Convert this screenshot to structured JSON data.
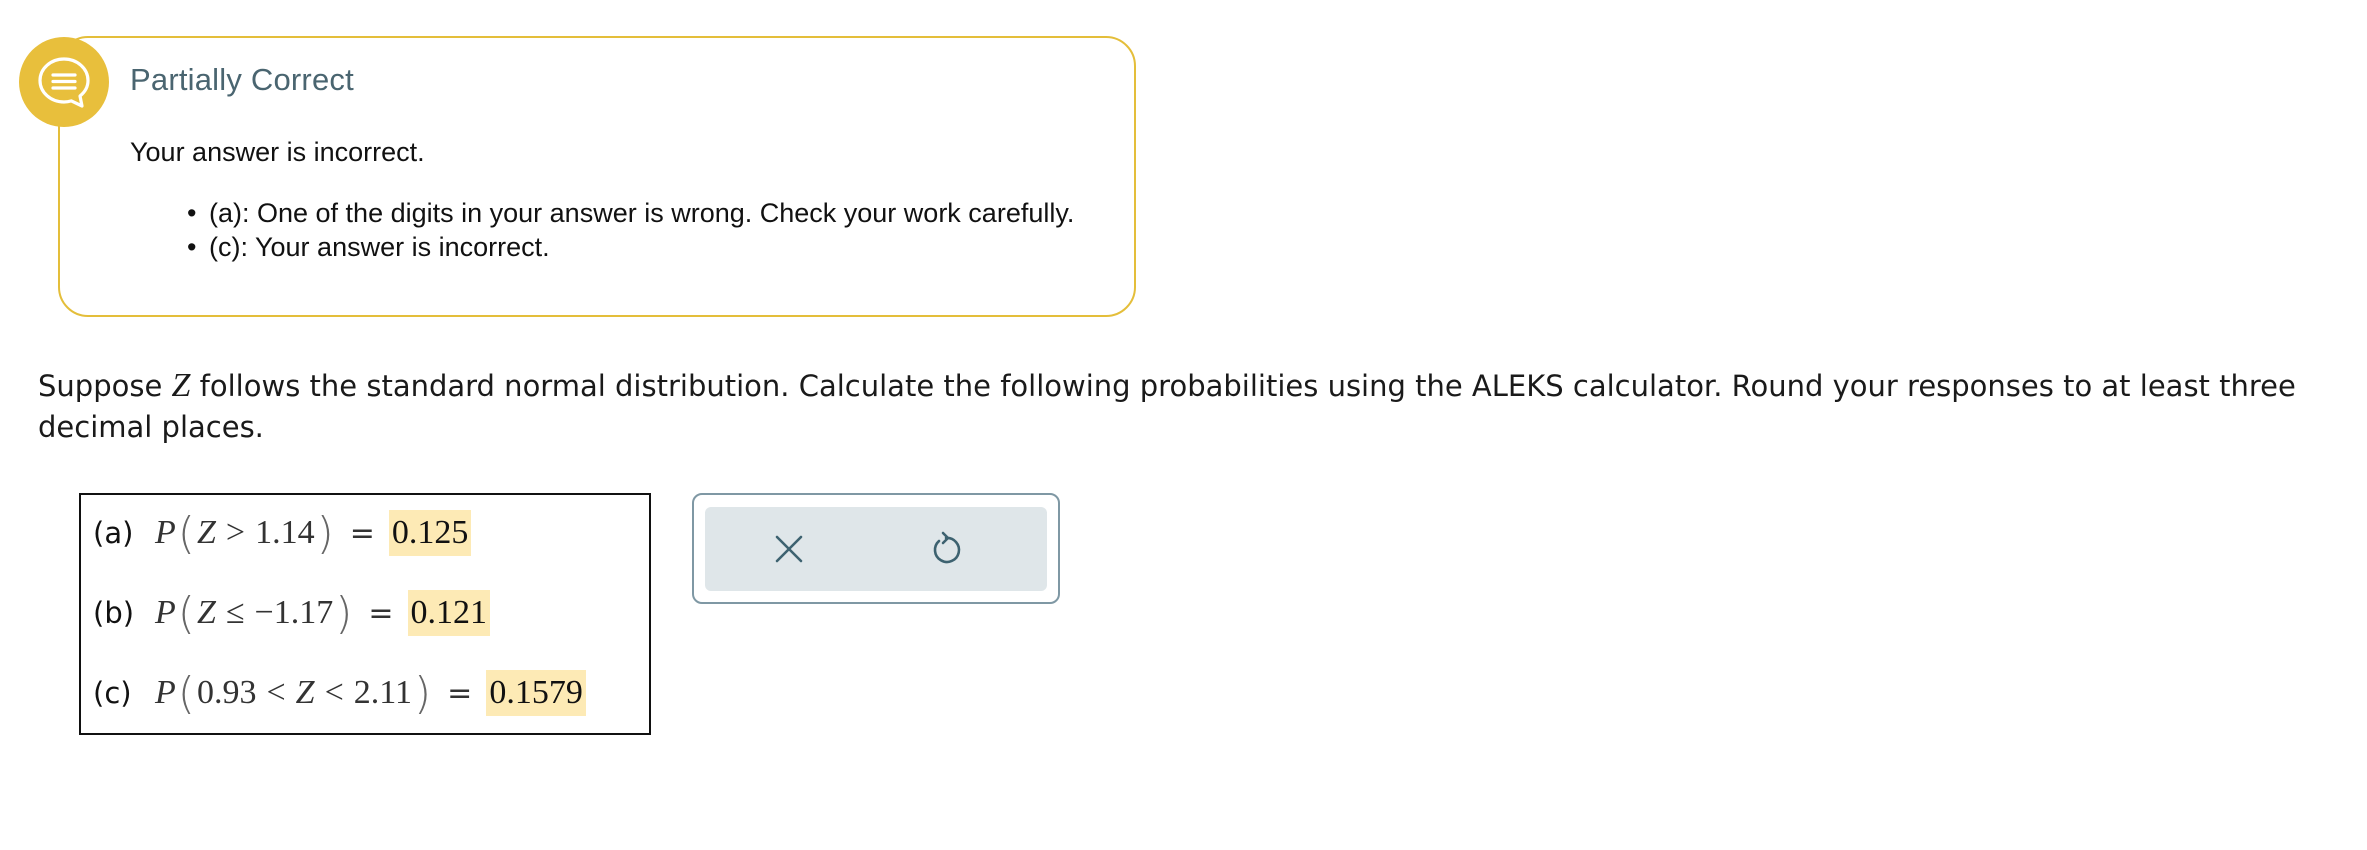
{
  "feedback": {
    "icon": "chat-bubble-icon",
    "title": "Partially Correct",
    "summary": "Your answer is incorrect.",
    "items": [
      "(a): One of the digits in your answer is wrong. Check your work carefully.",
      "(c): Your answer is incorrect."
    ],
    "colors": {
      "accent": "#e8bf3c",
      "title": "#4a6570"
    }
  },
  "problem": {
    "text_before": "Suppose ",
    "variable": "Z",
    "text_after": " follows the standard normal distribution. Calculate the following probabilities using the ALEKS calculator. Round your responses to at least three decimal places."
  },
  "parts": [
    {
      "label": "(a)",
      "func": "P",
      "expr_left": "Z",
      "relation": ">",
      "expr_right": "1.14",
      "equals": "=",
      "answer": "0.125"
    },
    {
      "label": "(b)",
      "func": "P",
      "expr_left": "Z",
      "relation": "≤",
      "expr_right": "−1.17",
      "equals": "=",
      "answer": "0.121"
    },
    {
      "label": "(c)",
      "func": "P",
      "expr_left": "0.93",
      "relation_1": "<",
      "middle": "Z",
      "relation_2": "<",
      "expr_right": "2.11",
      "equals": "=",
      "answer": "0.1579"
    }
  ],
  "tools": {
    "clear_icon": "close-icon",
    "undo_icon": "undo-icon"
  },
  "colors": {
    "answer_highlight": "#fdeab5",
    "tool_panel_border": "#7f98a4",
    "tool_panel_fill": "#dfe6e9"
  }
}
